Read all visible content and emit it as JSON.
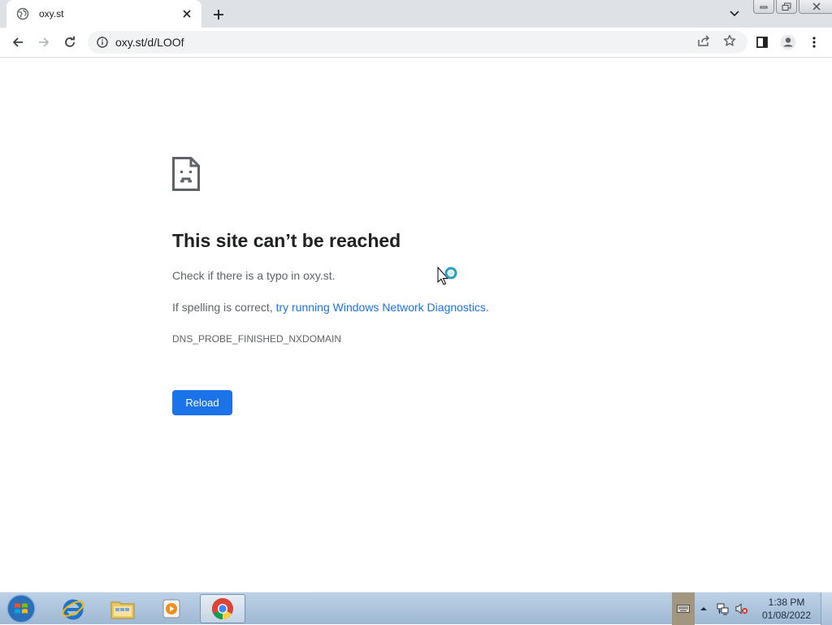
{
  "browser": {
    "tab": {
      "title": "oxy.st",
      "favicon": "globe-icon",
      "close_icon": "close-icon"
    },
    "new_tab_icon": "plus-icon",
    "tab_search_icon": "chevron-down-icon",
    "window_controls": [
      "minimize-icon",
      "restore-icon",
      "close-icon"
    ],
    "toolbar": {
      "back_icon": "arrow-left-icon",
      "forward_icon": "arrow-right-icon",
      "reload_icon": "reload-icon",
      "url": "oxy.st/d/LOOf",
      "site_info_icon": "info-icon",
      "share_icon": "share-icon",
      "bookmark_icon": "star-icon",
      "side_panel_icon": "side-panel-icon",
      "profile_icon": "profile-icon",
      "menu_icon": "kebab-menu-icon"
    }
  },
  "error_page": {
    "icon": "sad-document-icon",
    "title": "This site can’t be reached",
    "line1": "Check if there is a typo in oxy.st.",
    "line2_prefix": "If spelling is correct, ",
    "line2_link": "try running Windows Network Diagnostics",
    "line2_suffix": ".",
    "error_code": "DNS_PROBE_FINISHED_NXDOMAIN",
    "reload_label": "Reload",
    "accent_color": "#1a73e8"
  },
  "taskbar": {
    "start_icon": "windows-start-icon",
    "apps": [
      {
        "name": "internet-explorer-icon",
        "active": false
      },
      {
        "name": "file-explorer-icon",
        "active": false
      },
      {
        "name": "media-player-icon",
        "active": false
      },
      {
        "name": "chrome-icon",
        "active": true
      }
    ],
    "tray": [
      "keyboard-icon",
      "show-hidden-icons-icon",
      "network-icon",
      "volume-muted-icon"
    ],
    "time": "1:38 PM",
    "date": "01/08/2022"
  }
}
